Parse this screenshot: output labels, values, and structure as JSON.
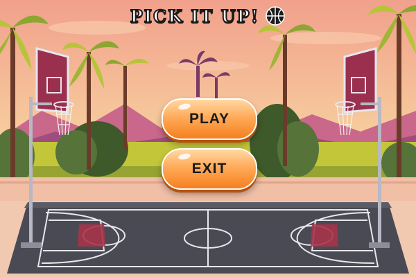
{
  "game": {
    "title": "PICK IT UP!",
    "title_icon": "basketball-icon"
  },
  "menu": {
    "play_label": "PLAY",
    "exit_label": "EXIT"
  },
  "colors": {
    "sky_top": "#f4a98c",
    "sky_bottom": "#f7d9a4",
    "button_orange": "#f58a2c",
    "court_dark": "#4a4a55",
    "court_red": "#a7344a",
    "grass": "#c7cc3a"
  }
}
